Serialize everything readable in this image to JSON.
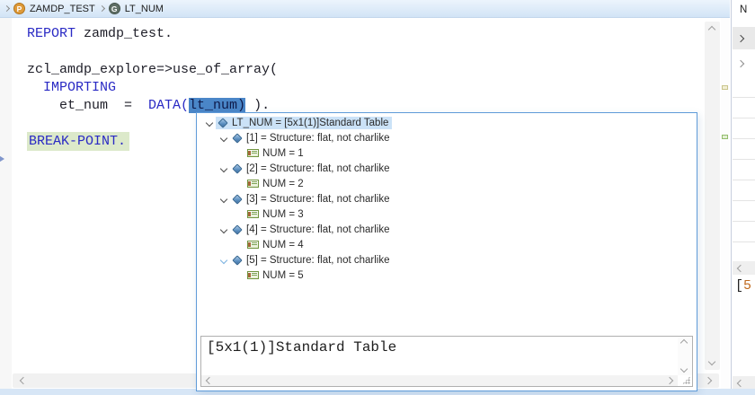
{
  "breadcrumb": {
    "items": [
      {
        "icon": "program-icon",
        "letter": "P",
        "label": "ZAMDP_TEST"
      },
      {
        "icon": "global-variable-icon",
        "letter": "G",
        "label": "LT_NUM"
      }
    ]
  },
  "editor": {
    "code_lines": [
      [
        {
          "t": "REPORT",
          "c": "kw"
        },
        {
          "t": " zamdp_test."
        }
      ],
      [],
      [
        {
          "t": "zcl_amdp_explore=>use_of_array("
        }
      ],
      [
        {
          "t": "  "
        },
        {
          "t": "IMPORTING",
          "c": "kw"
        }
      ],
      [
        {
          "t": "    et_num  =  "
        },
        {
          "t": "DATA(",
          "c": "kw"
        },
        {
          "t": "lt_num)",
          "c": "sel"
        },
        {
          "t": " )."
        }
      ],
      [],
      [
        {
          "t": "BREAK-POINT.",
          "c": "kw",
          "hl": true
        }
      ]
    ]
  },
  "popup": {
    "tree_rows": [
      {
        "level": 0,
        "expanded": true,
        "icon": "structure-icon",
        "label": "LT_NUM = [5x1(1)]Standard Table",
        "selected": true
      },
      {
        "level": 1,
        "expanded": true,
        "icon": "structure-icon",
        "label": "[1] = Structure: flat, not charlike"
      },
      {
        "level": 2,
        "icon": "field-icon",
        "label": "NUM = 1"
      },
      {
        "level": 1,
        "expanded": true,
        "icon": "structure-icon",
        "label": "[2] = Structure: flat, not charlike"
      },
      {
        "level": 2,
        "icon": "field-icon",
        "label": "NUM = 2"
      },
      {
        "level": 1,
        "expanded": true,
        "icon": "structure-icon",
        "label": "[3] = Structure: flat, not charlike"
      },
      {
        "level": 2,
        "icon": "field-icon",
        "label": "NUM = 3"
      },
      {
        "level": 1,
        "expanded": true,
        "icon": "structure-icon",
        "label": "[4] = Structure: flat, not charlike"
      },
      {
        "level": 2,
        "icon": "field-icon",
        "label": "NUM = 4"
      },
      {
        "level": 1,
        "expanded": true,
        "chevron_style": "light",
        "icon": "structure-icon",
        "label": "[5] = Structure: flat, not charlike"
      },
      {
        "level": 2,
        "icon": "field-icon",
        "label": "NUM = 5"
      }
    ],
    "detail_text": "[5x1(1)]Standard Table"
  },
  "variables_panel": {
    "name_column_header": "N",
    "rows": [
      {
        "expander": true,
        "selected": true
      },
      {
        "expander": true
      },
      {},
      {},
      {},
      {},
      {},
      {},
      {},
      {}
    ],
    "detail_partial": {
      "bracket": "[",
      "number": "5"
    }
  },
  "colors": {
    "keyword": "#2a2ac4",
    "identifier": "#1e1e28",
    "selection_bg": "#4a86c8",
    "selection_text": "#0e1a4a",
    "current_line_bg": "#dce9ca",
    "popup_border": "#5f9bd8",
    "tree_selection_bg": "#cbe2f7",
    "detail_number": "#c06a1f"
  }
}
